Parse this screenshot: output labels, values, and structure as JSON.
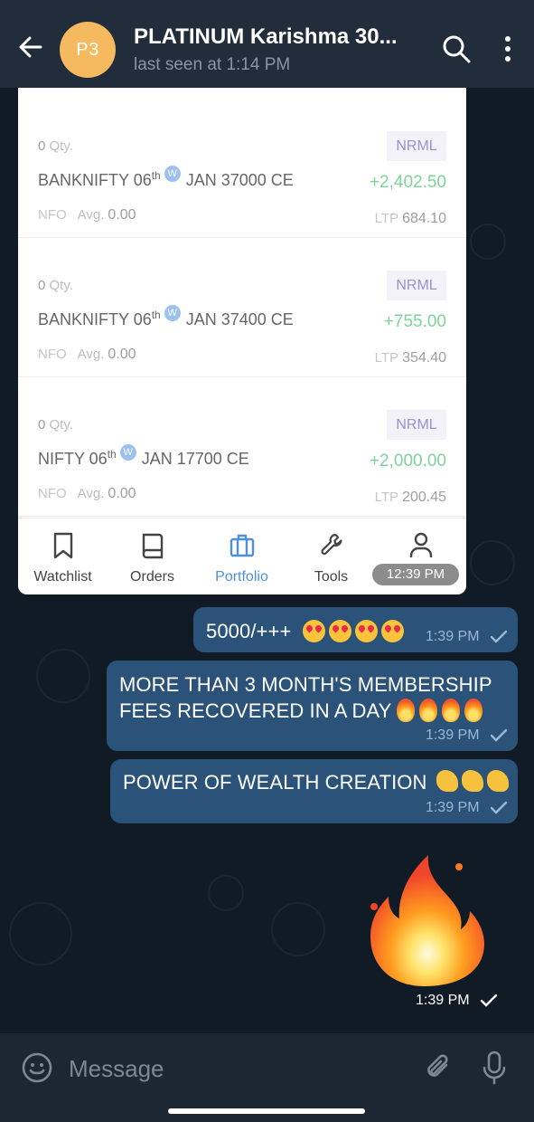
{
  "header": {
    "avatar_initials": "P3",
    "title": "PLATINUM Karishma 30...",
    "status": "last seen at 1:14 PM"
  },
  "screenshot": {
    "positions": [
      {
        "qty": "0",
        "qty_unit": "Qty.",
        "product": "NRML",
        "symbol": "BANKNIFTY 06",
        "sup": "th",
        "week_icon": "W",
        "symbol_rest": "JAN 37000 CE",
        "pnl": "+2,402.50",
        "exchange": "NFO",
        "avg_label": "Avg.",
        "avg": "0.00",
        "ltp_label": "LTP",
        "ltp": "684.10"
      },
      {
        "qty": "0",
        "qty_unit": "Qty.",
        "product": "NRML",
        "symbol": "BANKNIFTY 06",
        "sup": "th",
        "week_icon": "W",
        "symbol_rest": "JAN 37400 CE",
        "pnl": "+755.00",
        "exchange": "NFO",
        "avg_label": "Avg.",
        "avg": "0.00",
        "ltp_label": "LTP",
        "ltp": "354.40"
      },
      {
        "qty": "0",
        "qty_unit": "Qty.",
        "product": "NRML",
        "symbol": "NIFTY 06",
        "sup": "th",
        "week_icon": "W",
        "symbol_rest": "JAN 17700 CE",
        "pnl": "+2,000.00",
        "exchange": "NFO",
        "avg_label": "Avg.",
        "avg": "0.00",
        "ltp_label": "LTP",
        "ltp": "200.45"
      }
    ],
    "nav": [
      {
        "label": "Watchlist",
        "icon": "bookmark-icon"
      },
      {
        "label": "Orders",
        "icon": "book-icon"
      },
      {
        "label": "Portfolio",
        "icon": "briefcase-icon",
        "active": true
      },
      {
        "label": "Tools",
        "icon": "wrench-icon"
      },
      {
        "label": "",
        "icon": "user-icon"
      }
    ],
    "time": "12:39 PM"
  },
  "messages": [
    {
      "text": "5000/+++",
      "emoji": [
        "heart-eyes",
        "heart-eyes",
        "heart-eyes",
        "heart-eyes"
      ],
      "time": "1:39 PM"
    },
    {
      "text_line1": "MORE THAN 3 MONTH'S MEMBERSHIP",
      "text_line2": "FEES RECOVERED IN A DAY",
      "emoji": [
        "fire",
        "fire",
        "fire",
        "fire"
      ],
      "time": "1:39 PM"
    },
    {
      "text": "POWER OF WEALTH CREATION",
      "emoji": [
        "flexed-biceps",
        "flexed-biceps",
        "flexed-biceps"
      ],
      "time": "1:39 PM"
    },
    {
      "sticker": "fire-sticker",
      "time": "1:39 PM"
    }
  ],
  "composer": {
    "placeholder": "Message"
  },
  "colors": {
    "header_bg": "#212d3b",
    "bubble_out": "#2b5278",
    "avatar": "#f5b95f",
    "profit": "#7ed29b",
    "accent": "#4d8ee0"
  }
}
